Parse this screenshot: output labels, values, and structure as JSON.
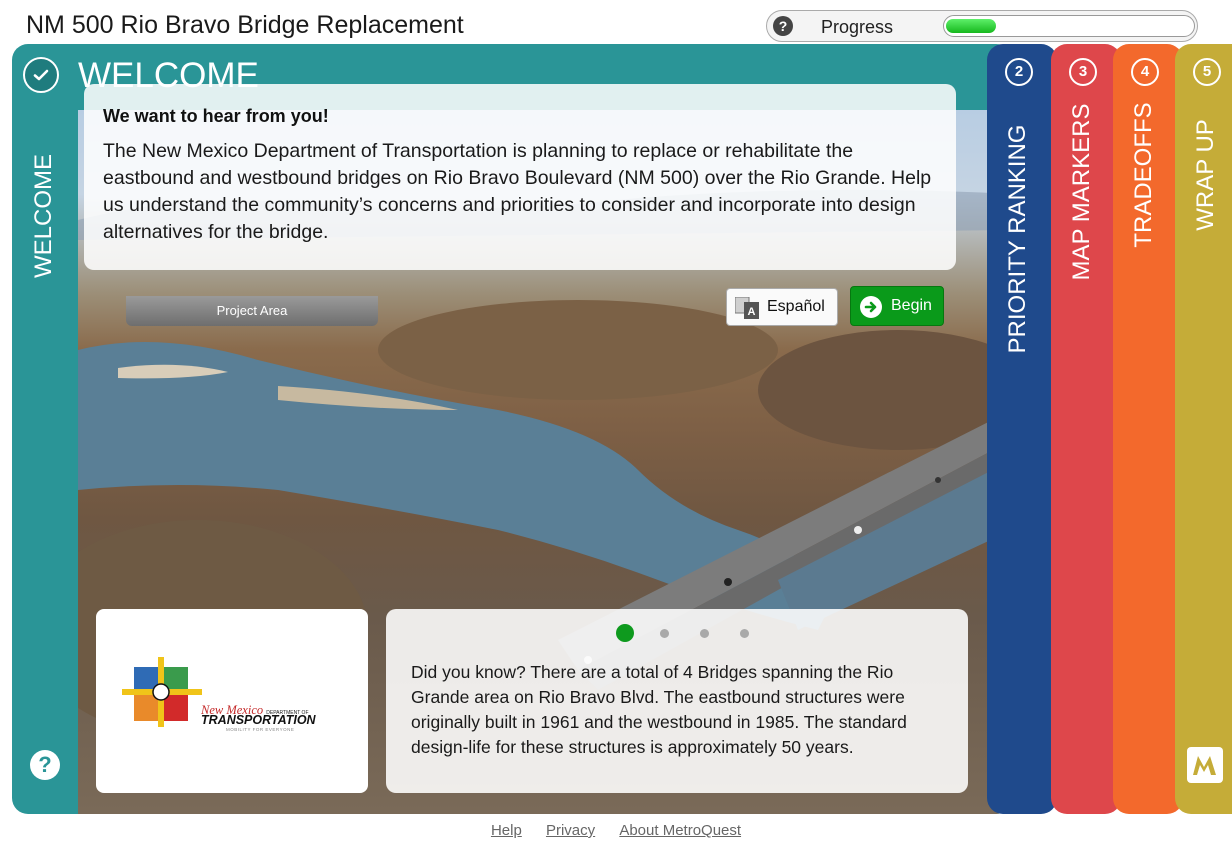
{
  "app": {
    "title": "NM 500 Rio Bravo Bridge Replacement"
  },
  "progress": {
    "label": "Progress",
    "value": 0.2
  },
  "welcome": {
    "heading": "WELCOME",
    "side_label": "WELCOME",
    "intro_heading": "We want to hear from you!",
    "intro_body": "The New Mexico Department of Transportation is planning to replace or rehabilitate the eastbound and westbound bridges on Rio Bravo Boulevard (NM 500) over the Rio Grande. Help us understand the community’s concerns and priorities to consider and incorporate into design alternatives for the bridge.",
    "project_area_label": "Project Area",
    "espanol_label": "Español",
    "begin_label": "Begin",
    "fact_text": "Did you know? There are a total of 4 Bridges spanning the Rio Grande area on Rio Bravo Blvd. The eastbound structures were originally built in 1961 and the westbound in 1985. The standard design-life for these structures is approximately 50 years.",
    "carousel_count": 4,
    "carousel_active": 1
  },
  "logo": {
    "line1": "New Mexico",
    "line1_small": "DEPARTMENT OF",
    "line2": "TRANSPORTATION",
    "tagline": "MOBILITY FOR EVERYONE"
  },
  "tabs": [
    {
      "number": "2",
      "label": "PRIORITY RANKING",
      "color": "#1f4a8c"
    },
    {
      "number": "3",
      "label": "MAP MARKERS",
      "color": "#de474b"
    },
    {
      "number": "4",
      "label": "TRADEOFFS",
      "color": "#f3692c"
    },
    {
      "number": "5",
      "label": "WRAP UP",
      "color": "#c5ac38"
    }
  ],
  "footer": {
    "links": [
      "Help",
      "Privacy",
      "About MetroQuest"
    ]
  },
  "colors": {
    "welcome": "#2a9597",
    "begin": "#0a9a1a",
    "progress": "#16b81d"
  }
}
